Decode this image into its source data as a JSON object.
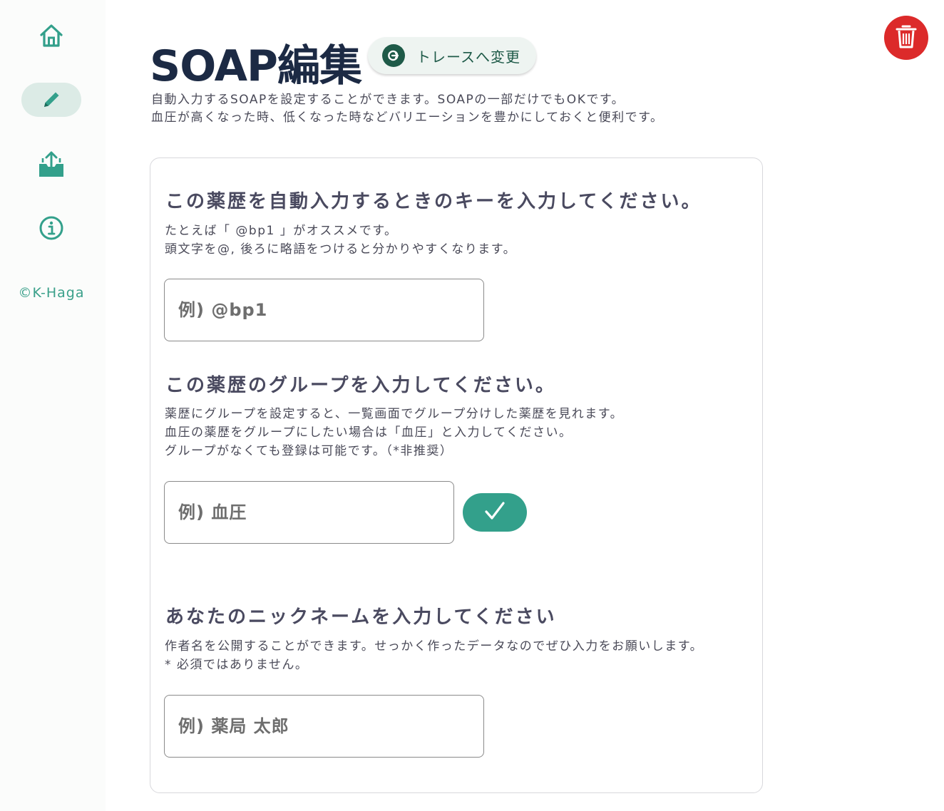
{
  "sidebar": {
    "items": [
      {
        "name": "home",
        "icon": "home-icon",
        "active": false
      },
      {
        "name": "edit",
        "icon": "pencil-icon",
        "active": true
      },
      {
        "name": "export",
        "icon": "upload-tray-icon",
        "active": false
      },
      {
        "name": "info",
        "icon": "info-icon",
        "active": false
      }
    ],
    "copyright": "©K-Haga"
  },
  "header": {
    "title": "SOAP編集",
    "trace_button": {
      "label": "トレースへ変更",
      "icon": "switch-arrow-icon"
    },
    "delete_button": {
      "icon": "trash-icon"
    },
    "description": [
      "自動入力するSOAPを設定することができます。SOAPの一部だけでもOKです。",
      "血圧が高くなった時、低くなった時などバリエーションを豊かにしておくと便利です。"
    ]
  },
  "form": {
    "key": {
      "heading": "この薬歴を自動入力するときのキーを入力してください。",
      "description": [
        "たとえば「 @bp1 」がオススメです。",
        "頭文字を@, 後ろに略語をつけると分かりやすくなります。"
      ],
      "placeholder": "例) @bp1",
      "value": ""
    },
    "group": {
      "heading": "この薬歴のグループを入力してください。",
      "description": [
        "薬歴にグループを設定すると、一覧画面でグループ分けした薬歴を見れます。",
        "血圧の薬歴をグループにしたい場合は「血圧」と入力してください。",
        "グループがなくても登録は可能です。（*非推奨）"
      ],
      "placeholder": "例) 血圧",
      "value": "",
      "confirm_icon": "checkmark-icon"
    },
    "nickname": {
      "heading": "あなたのニックネームを入力してください",
      "description": [
        "作者名を公開することができます。せっかく作ったデータなのでぜひ入力をお願いします。",
        "* 必須ではありません。"
      ],
      "placeholder": "例) 薬局 太郎",
      "value": ""
    }
  },
  "colors": {
    "accent": "#33a08b",
    "title": "#1c2a44",
    "danger": "#dc2a2a",
    "active_nav_bg": "#dcebe6"
  }
}
